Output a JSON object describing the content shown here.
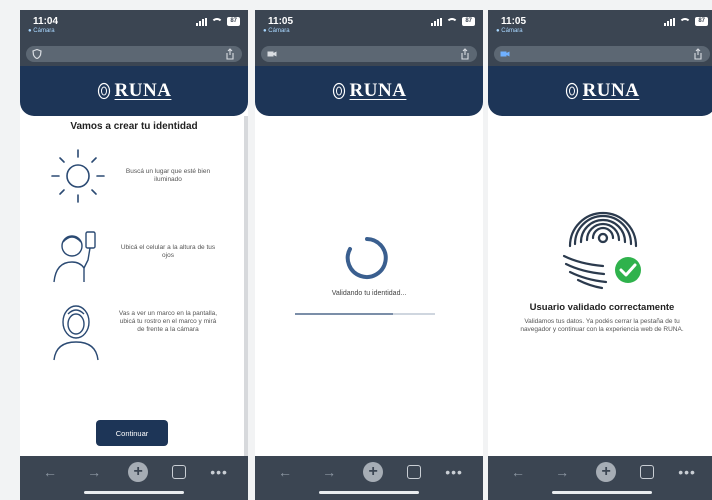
{
  "phones": [
    {
      "time": "11:04",
      "camera_label": "● Cámara",
      "battery": "87",
      "brand": "RUNA",
      "title": "Vamos a crear tu identidad",
      "tips": [
        {
          "icon": "sun-icon",
          "text": "Buscá un lugar que esté bien iluminado"
        },
        {
          "icon": "person-phone-icon",
          "text": "Ubicá el celular a la altura de tus ojos"
        },
        {
          "icon": "face-frame-icon",
          "text": "Vas a ver un marco en la pantalla, ubicá tu rostro en el marco y mirá de frente a la cámara"
        }
      ],
      "continue_label": "Continuar"
    },
    {
      "time": "11:05",
      "camera_label": "● Cámara",
      "battery": "87",
      "brand": "RUNA",
      "validating_text": "Validando tu identidad...",
      "progress": 0.7
    },
    {
      "time": "11:05",
      "camera_label": "● Cámara",
      "battery": "87",
      "brand": "RUNA",
      "success_title": "Usuario validado correctamente",
      "success_message": "Validamos tus datos. Ya podés cerrar la pestaña de tu navegador y continuar con la experiencia web de RUNA."
    }
  ],
  "colors": {
    "brand_navy": "#1d3557",
    "status_bar": "#3b4552",
    "success_green": "#2fb24c",
    "fingerprint": "#2b3a4d"
  },
  "toolbar_icons": [
    "back-arrow-icon",
    "forward-arrow-icon",
    "new-tab-plus-icon",
    "tabs-icon",
    "more-icon"
  ]
}
